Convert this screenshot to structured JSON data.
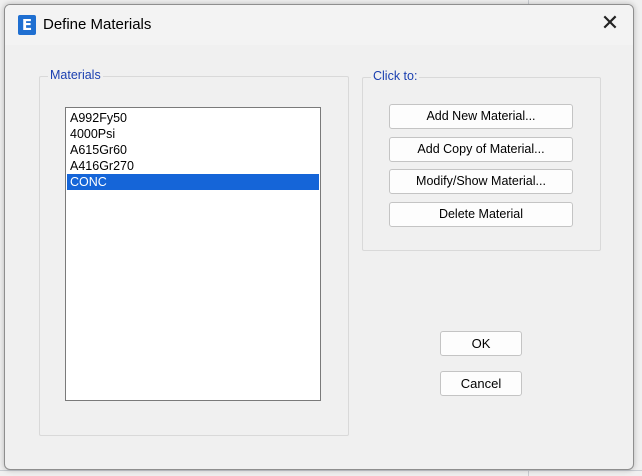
{
  "window": {
    "title": "Define Materials",
    "icon_letter": "E",
    "close_glyph": "✕"
  },
  "materials": {
    "label": "Materials",
    "items": [
      "A992Fy50",
      "4000Psi",
      "A615Gr60",
      "A416Gr270",
      "CONC"
    ],
    "selected": "CONC"
  },
  "click_to": {
    "label": "Click to:",
    "add_new": "Add New Material...",
    "add_copy": "Add Copy of Material...",
    "modify_show": "Modify/Show Material...",
    "delete": "Delete Material"
  },
  "buttons": {
    "ok": "OK",
    "cancel": "Cancel"
  },
  "colors": {
    "selection": "#1565d8",
    "group_label": "#1a3fb0",
    "app_icon": "#1f6fd1"
  }
}
